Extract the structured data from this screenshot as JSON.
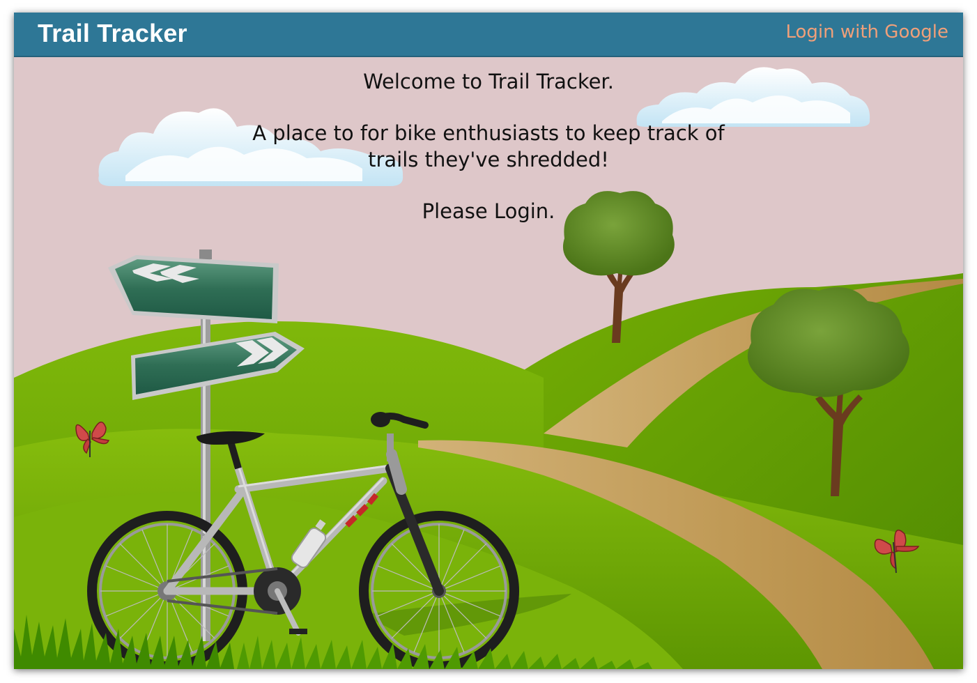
{
  "navbar": {
    "brand": "Trail Tracker",
    "login_label": "Login with Google"
  },
  "main": {
    "welcome": "Welcome to Trail Tracker.",
    "tagline": "A place to for bike enthusiasts to keep track of trails they've shredded!",
    "prompt": "Please Login."
  },
  "colors": {
    "navbar": "#2e7796",
    "login_link": "#f0a07a",
    "sky": "#dec7c9",
    "hills": "#7ab800"
  },
  "background": {
    "elements": [
      "cloud",
      "cloud",
      "signpost",
      "bicycle",
      "tree",
      "tree",
      "dirt-path",
      "butterfly",
      "butterfly",
      "grass"
    ]
  }
}
